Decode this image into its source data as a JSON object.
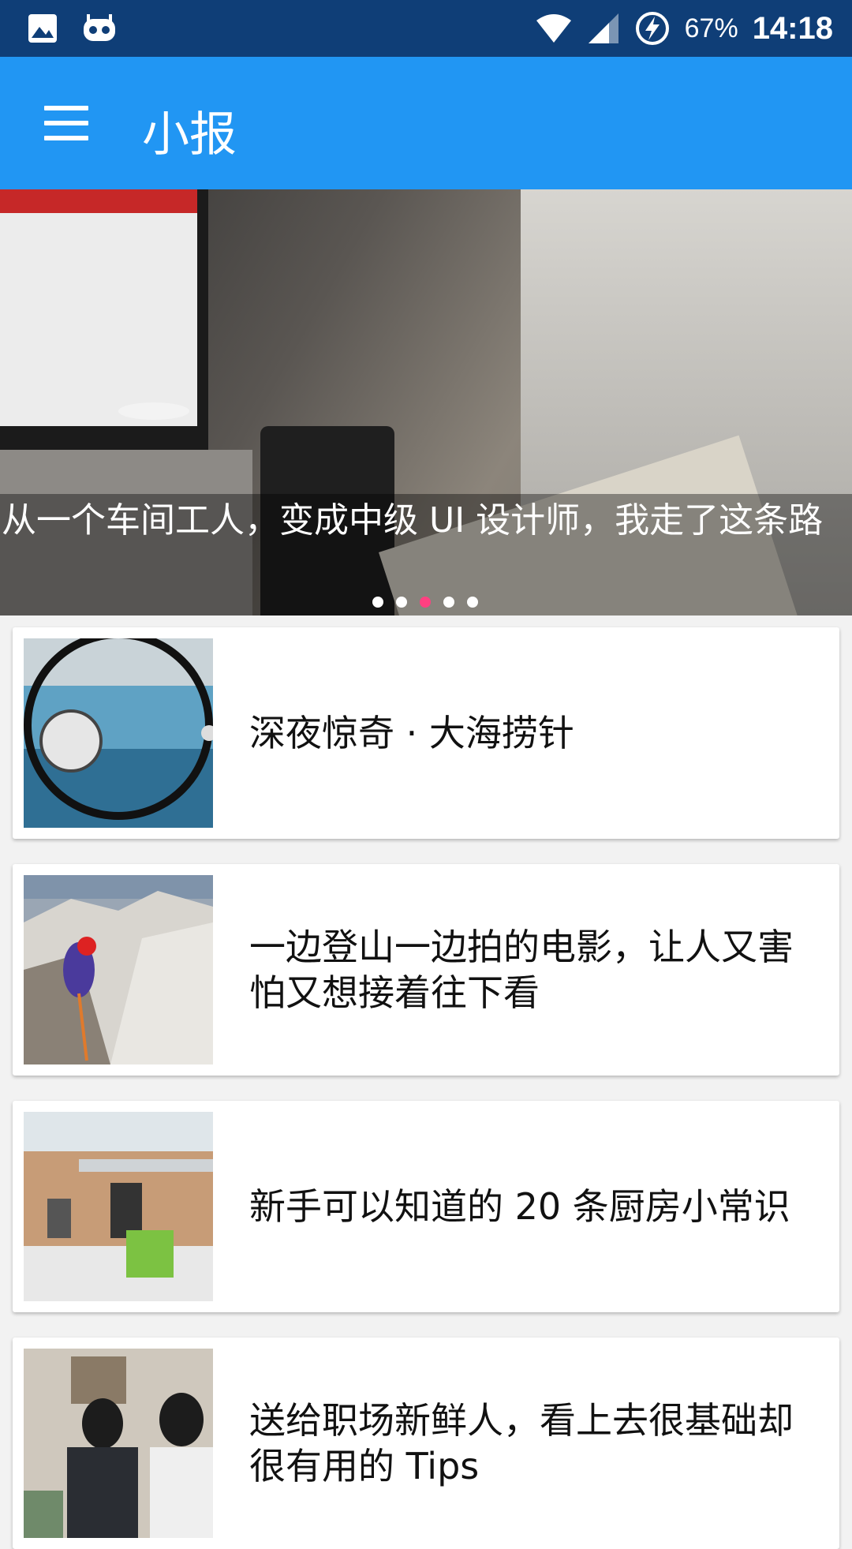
{
  "status_bar": {
    "battery": "67%",
    "time": "14:18",
    "icons": [
      "image-icon",
      "robot-icon",
      "wifi-icon",
      "signal-icon",
      "battery-charging-icon"
    ]
  },
  "app_bar": {
    "title": "小报",
    "menu_icon": "hamburger-menu-icon",
    "color": "#2196f3"
  },
  "banner": {
    "caption": "从一个车间工人，变成中级 UI 设计师，我走了这条路",
    "pager": {
      "count": 5,
      "active_index": 2
    },
    "indicator_active_color": "#ff4081"
  },
  "articles": [
    {
      "title": "深夜惊奇 · 大海捞针"
    },
    {
      "title": "一边登山一边拍的电影，让人又害怕又想接着往下看"
    },
    {
      "title": "新手可以知道的 20 条厨房小常识"
    },
    {
      "title": "送给职场新鲜人，看上去很基础却很有用的 Tips"
    }
  ]
}
